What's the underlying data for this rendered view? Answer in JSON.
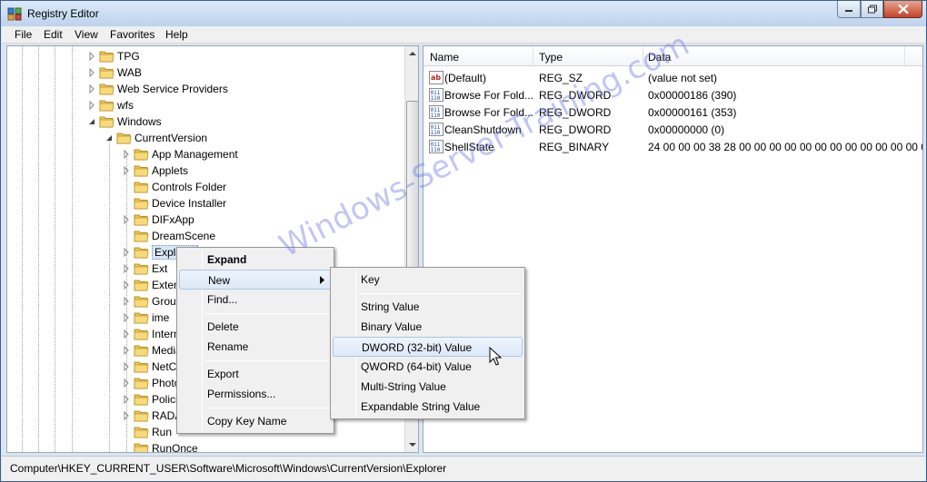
{
  "window": {
    "title": "Registry Editor"
  },
  "menu": [
    "File",
    "Edit",
    "View",
    "Favorites",
    "Help"
  ],
  "tree": {
    "items": [
      {
        "label": "TPG",
        "expander": "collapsed"
      },
      {
        "label": "WAB",
        "expander": "collapsed"
      },
      {
        "label": "Web Service Providers",
        "expander": "collapsed"
      },
      {
        "label": "wfs",
        "expander": "collapsed"
      },
      {
        "label": "Windows",
        "expander": "expanded"
      },
      {
        "label": "CurrentVersion",
        "expander": "expanded"
      },
      {
        "label": "App Management",
        "expander": "collapsed"
      },
      {
        "label": "Applets",
        "expander": "collapsed"
      },
      {
        "label": "Controls Folder",
        "expander": "none"
      },
      {
        "label": "Device Installer",
        "expander": "none"
      },
      {
        "label": "DIFxApp",
        "expander": "collapsed"
      },
      {
        "label": "DreamScene",
        "expander": "none"
      },
      {
        "label": "Explorer",
        "expander": "collapsed",
        "selected": true
      },
      {
        "label": "Ext",
        "expander": "collapsed"
      },
      {
        "label": "Extensions",
        "expander": "collapsed"
      },
      {
        "label": "Group Policy",
        "expander": "collapsed"
      },
      {
        "label": "ime",
        "expander": "collapsed"
      },
      {
        "label": "Internet Settings",
        "expander": "collapsed"
      },
      {
        "label": "Media Center",
        "expander": "collapsed"
      },
      {
        "label": "NetCache",
        "expander": "collapsed"
      },
      {
        "label": "Photo Acquisition",
        "expander": "collapsed"
      },
      {
        "label": "Policies",
        "expander": "collapsed"
      },
      {
        "label": "RADAR",
        "expander": "collapsed"
      },
      {
        "label": "Run",
        "expander": "none"
      },
      {
        "label": "RunOnce",
        "expander": "none"
      }
    ]
  },
  "list": {
    "columns": [
      "Name",
      "Type",
      "Data"
    ],
    "rows": [
      {
        "icon": "string-value-icon",
        "name": "(Default)",
        "type": "REG_SZ",
        "data": "(value not set)"
      },
      {
        "icon": "binary-value-icon",
        "name": "Browse For Fold...",
        "type": "REG_DWORD",
        "data": "0x00000186 (390)"
      },
      {
        "icon": "binary-value-icon",
        "name": "Browse For Fold...",
        "type": "REG_DWORD",
        "data": "0x00000161 (353)"
      },
      {
        "icon": "binary-value-icon",
        "name": "CleanShutdown",
        "type": "REG_DWORD",
        "data": "0x00000000 (0)"
      },
      {
        "icon": "binary-value-icon",
        "name": "ShellState",
        "type": "REG_BINARY",
        "data": "24 00 00 00 38 28 00 00 00 00 00 00 00 00 00 00 00 00 0..."
      }
    ]
  },
  "context_menu": {
    "items": [
      "Expand",
      "New",
      "Find...",
      "Delete",
      "Rename",
      "Export",
      "Permissions...",
      "Copy Key Name"
    ],
    "hot_item": "New"
  },
  "submenu": {
    "items": [
      "Key",
      "String Value",
      "Binary Value",
      "DWORD (32-bit) Value",
      "QWORD (64-bit) Value",
      "Multi-String Value",
      "Expandable String Value"
    ],
    "hot_item": "DWORD (32-bit) Value"
  },
  "status": {
    "path": "Computer\\HKEY_CURRENT_USER\\Software\\Microsoft\\Windows\\CurrentVersion\\Explorer"
  },
  "watermark": "Windows-Server-Training.com",
  "colors": {
    "folder": "#f2c94c",
    "selection": "#d9e8f8",
    "menu_hot": "#dce9f8",
    "watermark": "#6e78e6"
  }
}
